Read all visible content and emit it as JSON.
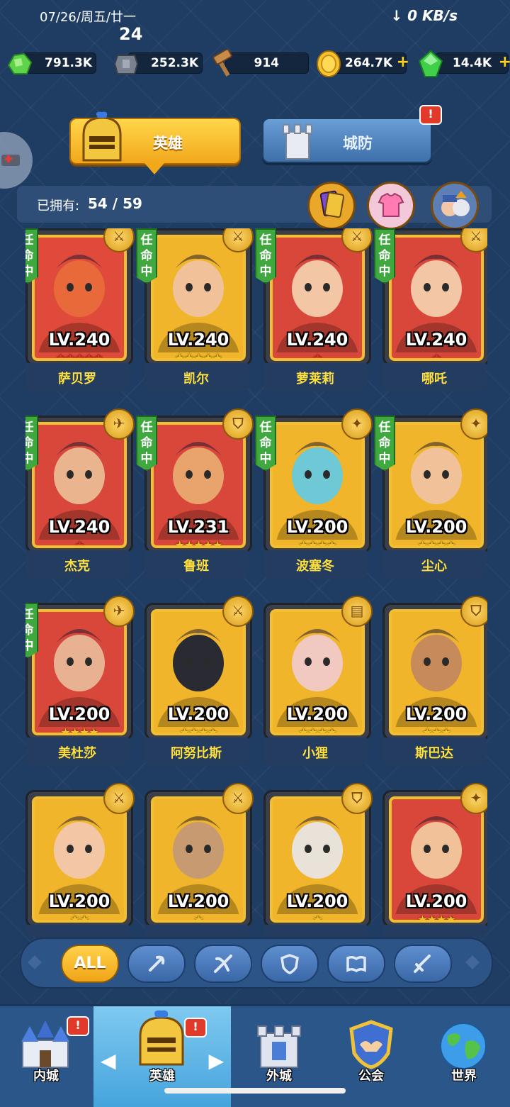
{
  "status": {
    "date": "07/26/周五/廿一",
    "count": "24",
    "speed": "↓ 0 KB/s"
  },
  "resources": [
    {
      "value": "791.3K",
      "icon": "green-ore-icon",
      "plus": ""
    },
    {
      "value": "252.3K",
      "icon": "stone-icon",
      "plus": ""
    },
    {
      "value": "914",
      "icon": "hammer-icon",
      "plus": ""
    },
    {
      "value": "264.7K",
      "icon": "gold-coin-icon",
      "plus": "+"
    },
    {
      "value": "14.4K",
      "icon": "green-gem-icon",
      "plus": "+"
    }
  ],
  "tabs": {
    "hero": "英雄",
    "defense": "城防",
    "alert": "!"
  },
  "owned": {
    "label": "已拥有:",
    "count": "54 / 59"
  },
  "heroes": [
    {
      "name": "萨贝罗",
      "lv": "LV.240",
      "stars": "★★★★★",
      "star_color": "#e8372e",
      "bg": "#e04a3a",
      "skin": "#e86a3a",
      "role": "⚔",
      "appointed": true
    },
    {
      "name": "凯尔",
      "lv": "LV.240",
      "stars": "★★★★★",
      "star_color": "#f3c21f",
      "bg": "#f0b52a",
      "skin": "#f1c29a",
      "role": "⚔",
      "appointed": true
    },
    {
      "name": "萝莱莉",
      "lv": "LV.240",
      "stars": "★",
      "star_color": "#e8372e",
      "bg": "#d9473b",
      "skin": "#f3c7a6",
      "role": "⚔",
      "appointed": true
    },
    {
      "name": "哪吒",
      "lv": "LV.240",
      "stars": "★",
      "star_color": "#e8372e",
      "bg": "#d9473b",
      "skin": "#f3c7a6",
      "role": "⚔",
      "appointed": true
    },
    {
      "name": "杰克",
      "lv": "LV.240",
      "stars": "★",
      "star_color": "#e8372e",
      "bg": "#d9473b",
      "skin": "#e9b48e",
      "role": "✈",
      "appointed": true
    },
    {
      "name": "鲁班",
      "lv": "LV.231",
      "stars": "★★★★★",
      "star_color": "#f3c21f",
      "bg": "#d9473b",
      "skin": "#e9a46e",
      "role": "⛉",
      "appointed": true
    },
    {
      "name": "波塞冬",
      "lv": "LV.200",
      "stars": "★★★★",
      "star_color": "#f3c21f",
      "bg": "#f0b52a",
      "skin": "#6ec8d6",
      "role": "✦",
      "appointed": true
    },
    {
      "name": "尘心",
      "lv": "LV.200",
      "stars": "★★★★",
      "star_color": "#f3c21f",
      "bg": "#f0b52a",
      "skin": "#f1c29a",
      "role": "✦",
      "appointed": true
    },
    {
      "name": "美杜莎",
      "lv": "LV.200",
      "stars": "★★★★",
      "star_color": "#f3c21f",
      "bg": "#d9473b",
      "skin": "#e8b292",
      "role": "✈",
      "appointed": true
    },
    {
      "name": "阿努比斯",
      "lv": "LV.200",
      "stars": "★★★★",
      "star_color": "#f3c21f",
      "bg": "#f0b52a",
      "skin": "#2a2a33",
      "role": "⚔",
      "appointed": false
    },
    {
      "name": "小狸",
      "lv": "LV.200",
      "stars": "★★★★",
      "star_color": "#f3c21f",
      "bg": "#f0b52a",
      "skin": "#f1c9c0",
      "role": "▤",
      "appointed": false
    },
    {
      "name": "斯巴达",
      "lv": "LV.200",
      "stars": "★★★",
      "star_color": "#f3c21f",
      "bg": "#f0b52a",
      "skin": "#c78a5a",
      "role": "⛉",
      "appointed": false
    },
    {
      "name": "",
      "lv": "LV.200",
      "stars": "★★",
      "star_color": "#f3c21f",
      "bg": "#f0b52a",
      "skin": "#f3c7a6",
      "role": "⚔",
      "appointed": false
    },
    {
      "name": "",
      "lv": "LV.200",
      "stars": "★",
      "star_color": "#f3c21f",
      "bg": "#f0b52a",
      "skin": "#c89a72",
      "role": "⚔",
      "appointed": false
    },
    {
      "name": "",
      "lv": "LV.200",
      "stars": "★",
      "star_color": "#f3c21f",
      "bg": "#f0b52a",
      "skin": "#e8e2d8",
      "role": "⛉",
      "appointed": false
    },
    {
      "name": "",
      "lv": "LV.200",
      "stars": "★★★★",
      "star_color": "#f3c21f",
      "bg": "#d9473b",
      "skin": "#f1c29a",
      "role": "✦",
      "appointed": false
    }
  ],
  "appointed_label": "任\n命\n中",
  "filters": [
    {
      "label": "ALL",
      "icon": "all-filter",
      "active": true
    },
    {
      "label": "",
      "icon": "caster-filter-icon",
      "active": false
    },
    {
      "label": "",
      "icon": "ranged-filter-icon",
      "active": false
    },
    {
      "label": "",
      "icon": "shield-filter-icon",
      "active": false
    },
    {
      "label": "",
      "icon": "book-filter-icon",
      "active": false
    },
    {
      "label": "",
      "icon": "sword-filter-icon",
      "active": false
    }
  ],
  "nav": [
    {
      "label": "内城",
      "icon": "inner-city-icon",
      "alert": true,
      "active": false
    },
    {
      "label": "英雄",
      "icon": "hero-helmet-icon",
      "alert": true,
      "active": true
    },
    {
      "label": "外城",
      "icon": "outer-city-icon",
      "alert": false,
      "active": false
    },
    {
      "label": "公会",
      "icon": "guild-icon",
      "alert": false,
      "active": false
    },
    {
      "label": "世界",
      "icon": "world-globe-icon",
      "alert": false,
      "active": false
    }
  ],
  "nav_arrows": {
    "left": "◀",
    "right": "▶"
  },
  "colors": {
    "accent_gold": "#f3bf31",
    "bg_navy": "#1f3c63",
    "name_yellow": "#ffdf3a",
    "appointed_green": "#3fa83f"
  }
}
